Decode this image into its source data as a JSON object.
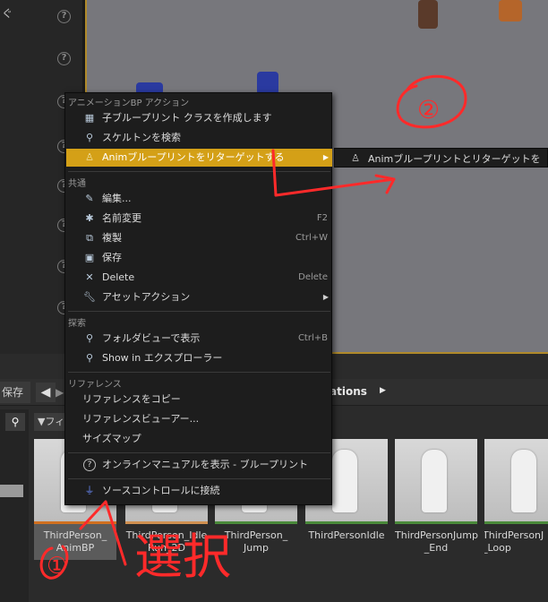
{
  "colors": {
    "highlight": "#d4a017",
    "annotation": "#ff2a2a",
    "viewport_border": "#b08a2a"
  },
  "left_panel": {
    "fragment_text": "ぐ",
    "help_icon": "?"
  },
  "menu": {
    "section_anim": "アニメーションBP アクション",
    "create_child_bp": "子ブループリント クラスを作成します",
    "find_skeleton": "スケルトンを検索",
    "retarget_anim_bp": "Animブループリントをリターゲットする",
    "section_common": "共通",
    "edit": "編集...",
    "rename": "名前変更",
    "rename_shortcut": "F2",
    "duplicate": "複製",
    "duplicate_shortcut": "Ctrl+W",
    "save": "保存",
    "delete": "Delete",
    "delete_shortcut": "Delete",
    "asset_actions": "アセットアクション",
    "section_explore": "探索",
    "show_in_folder_view": "フォルダビューで表示",
    "show_in_folder_view_shortcut": "Ctrl+B",
    "show_in_explorer": "Show in エクスプローラー",
    "section_references": "リファレンス",
    "copy_reference": "リファレンスをコピー",
    "reference_viewer": "リファレンスビューアー...",
    "size_map": "サイズマップ",
    "online_manual": "オンラインマニュアルを表示 - ブループリント",
    "connect_source_control": "ソースコントロールに接続"
  },
  "submenu": {
    "label": "Animブループリントとリターゲットを"
  },
  "content_browser": {
    "save_label": "保存",
    "back_arrow": "◀",
    "forward_arrow": "▶",
    "breadcrumb": "ations",
    "breadcrumb_arrow": "▶",
    "filter_label": "▼フィ",
    "search_icon": "⚲",
    "assets": [
      {
        "name": "ThirdPerson_ AnimBP"
      },
      {
        "name": "ThirdPerson_Idle Run_2D"
      },
      {
        "name": "ThirdPerson_ Jump"
      },
      {
        "name": "ThirdPersonIdle"
      },
      {
        "name": "ThirdPersonJump _End"
      },
      {
        "name": "ThirdPersonJ _Loop"
      }
    ]
  },
  "annotations": {
    "circle_two": "②",
    "circle_one": "①",
    "handwritten": "選択"
  }
}
